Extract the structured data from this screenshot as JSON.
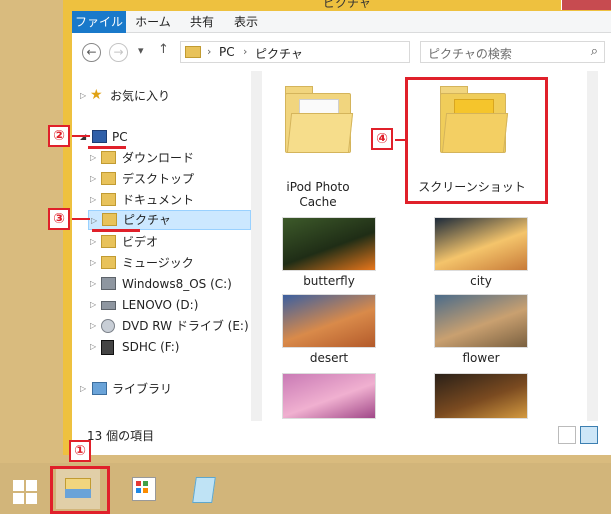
{
  "window": {
    "title": "ピクチャ"
  },
  "ribbon": {
    "tabs": [
      {
        "label": "ファイル",
        "active": true
      },
      {
        "label": "ホーム",
        "active": false
      },
      {
        "label": "共有",
        "active": false
      },
      {
        "label": "表示",
        "active": false
      }
    ]
  },
  "address": {
    "back_glyph": "←",
    "forward_glyph": "→",
    "recent_glyph": "▾",
    "up_glyph": "↑",
    "separator": "›",
    "path": [
      "PC",
      "ピクチャ"
    ],
    "dropdown_glyph": "▾",
    "refresh_glyph": "↻",
    "search_placeholder": "ピクチャの検索",
    "search_glyph": "⌕"
  },
  "nav": {
    "items": [
      {
        "label": "お気に入り",
        "icon": "star-icon"
      },
      {
        "label": "PC",
        "icon": "pc-icon"
      },
      {
        "label": "ダウンロード",
        "icon": "folder-icon"
      },
      {
        "label": "デスクトップ",
        "icon": "folder-icon"
      },
      {
        "label": "ドキュメント",
        "icon": "folder-icon"
      },
      {
        "label": "ピクチャ",
        "icon": "folder-icon",
        "selected": true
      },
      {
        "label": "ビデオ",
        "icon": "folder-icon"
      },
      {
        "label": "ミュージック",
        "icon": "folder-icon"
      },
      {
        "label": "Windows8_OS (C:)",
        "icon": "drive-icon"
      },
      {
        "label": "LENOVO (D:)",
        "icon": "drive-icon"
      },
      {
        "label": "DVD RW ドライブ (E:) .",
        "icon": "disc-icon"
      },
      {
        "label": "SDHC (F:)",
        "icon": "sd-icon"
      },
      {
        "label": "ライブラリ",
        "icon": "library-icon"
      }
    ],
    "expand_glyph": "▷",
    "expanded_glyph": "◢",
    "star_glyph": "★"
  },
  "content": {
    "folders": [
      {
        "label_line1": "iPod Photo",
        "label_line2": "Cache"
      },
      {
        "label_line1": "スクリーンショット",
        "label_line2": ""
      }
    ],
    "images": [
      {
        "label": "butterfly",
        "colors": [
          "#3d5a2a",
          "#e8761b",
          "#1f2d16"
        ]
      },
      {
        "label": "city",
        "colors": [
          "#1c2a3a",
          "#c77a38",
          "#f4c46b"
        ]
      },
      {
        "label": "desert",
        "colors": [
          "#3b5fa0",
          "#b35a2a",
          "#d98a4a"
        ]
      },
      {
        "label": "flower",
        "colors": [
          "#4a6b8a",
          "#7a6040",
          "#c9a070"
        ]
      },
      {
        "label": "",
        "colors": [
          "#c97ab5",
          "#a04888",
          "#f0b0d0"
        ]
      },
      {
        "label": "",
        "colors": [
          "#2a2018",
          "#d49a40",
          "#7a4a20"
        ]
      }
    ]
  },
  "status": {
    "count": "13 個の項目"
  },
  "annotations": {
    "one": "①",
    "two": "②",
    "three": "③",
    "four": "④"
  },
  "colors": {
    "accent": "#1979ca",
    "marker": "#e0202a",
    "selection": "#cce8ff"
  }
}
